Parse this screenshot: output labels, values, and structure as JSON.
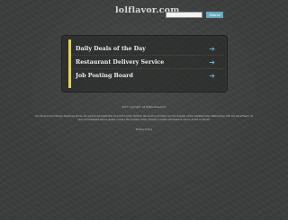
{
  "header": {
    "logo": "lolflavor.com",
    "search": {
      "placeholder": "",
      "button_label": "Search"
    }
  },
  "deals": [
    {
      "label": "Daily Deals of the Day",
      "icon": "arrow-right-icon"
    },
    {
      "label": "Restaurant Delivery Service",
      "icon": "arrow-right-icon"
    },
    {
      "label": "Job Posting Board",
      "icon": "arrow-right-icon"
    }
  ],
  "footer": {
    "copyright": "2013 Copyright. All Rights Reserved.",
    "disclaimer_line1": "The Sponsored Listings displayed above are served automatically by a third party. Neither the service provider nor the domain owner maintain any relationship with the advertisers. In",
    "disclaimer_line2": "case of trademark issues please contact the domain owner directly (contact information can be found in whois).",
    "privacy_link": "Privacy Policy"
  },
  "colors": {
    "background": "#3b3d3c",
    "accent_yellow": "#e2d44a",
    "arrow_blue": "#5fb1d2",
    "button_blue": "#6aaac2"
  },
  "arrow_glyph": "➔"
}
